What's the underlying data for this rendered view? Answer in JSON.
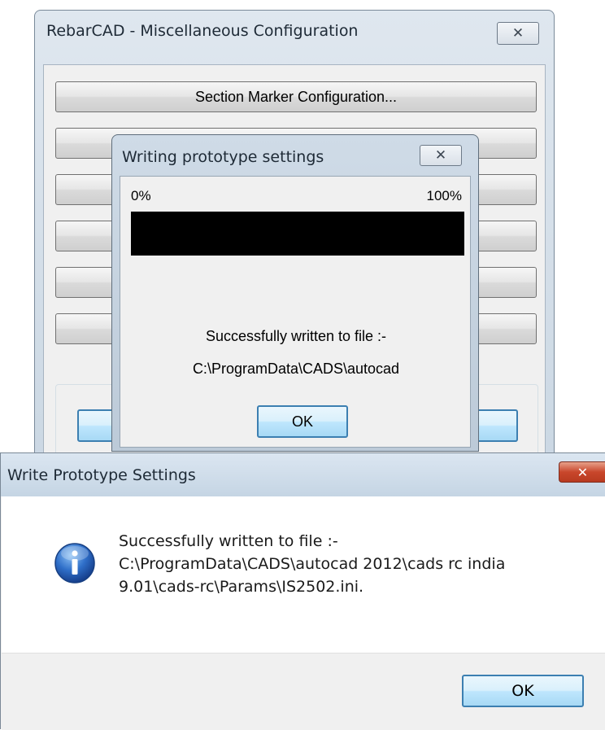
{
  "main_window": {
    "title": "RebarCAD - Miscellaneous Configuration",
    "close_glyph": "✕",
    "section_marker_button": "Section Marker Configuration..."
  },
  "progress_dialog": {
    "title": "Writing prototype settings",
    "close_glyph": "✕",
    "start_label": "0%",
    "end_label": "100%",
    "progress_fraction": 1.0,
    "message_line1": "Successfully written to file :-",
    "message_line2": "C:\\ProgramData\\CADS\\autocad",
    "ok_label": "OK"
  },
  "message_box": {
    "title": "Write Prototype Settings",
    "close_glyph": "✕",
    "icon": "information-icon",
    "line1": "Successfully written to file :-",
    "line2": "C:\\ProgramData\\CADS\\autocad 2012\\cads rc india",
    "line3": "9.01\\cads-rc\\Params\\IS2502.ini.",
    "ok_label": "OK"
  },
  "colors": {
    "close_red": "#c9472c",
    "default_button_border": "#3c7fb1",
    "progress_fill": "#000000"
  }
}
